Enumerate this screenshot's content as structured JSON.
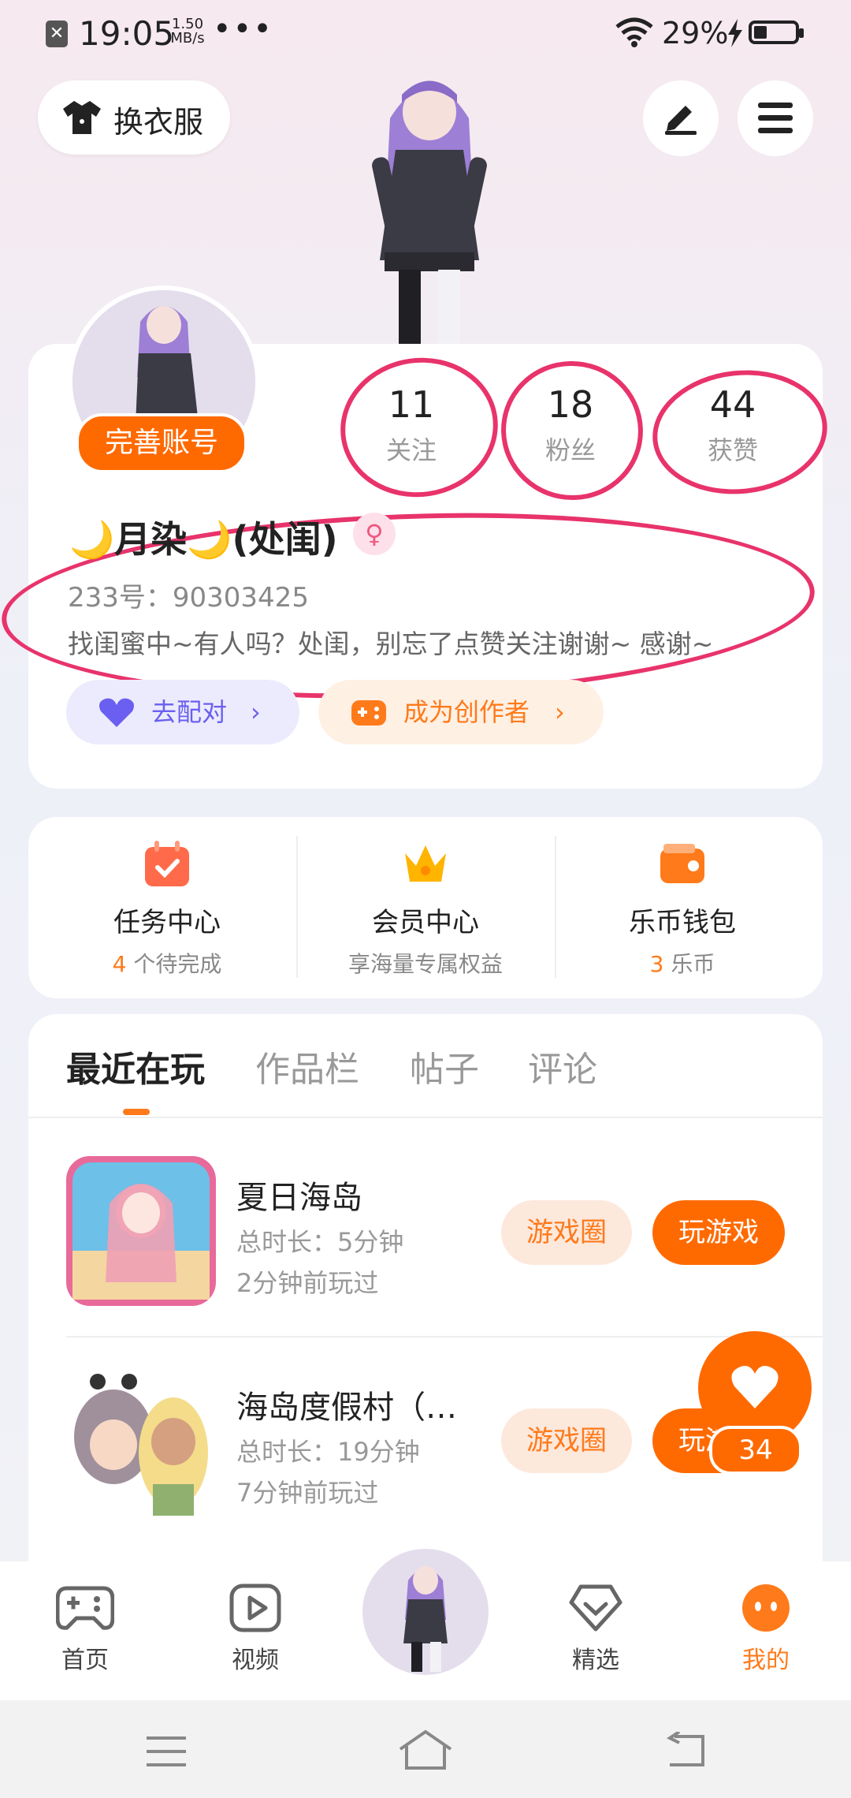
{
  "status_bar": {
    "time": "19:05",
    "speed_value": "1.50",
    "speed_unit": "MB/s",
    "more": "•••",
    "battery_pct": "29%"
  },
  "top": {
    "outfit_label": "换衣服",
    "edit_icon": "edit-icon",
    "menu_icon": "menu-icon"
  },
  "profile": {
    "complete_account": "完善账号",
    "stats": [
      {
        "num": "11",
        "label": "关注"
      },
      {
        "num": "18",
        "label": "粉丝"
      },
      {
        "num": "44",
        "label": "获赞"
      }
    ],
    "name": "🌙月染🌙(处闺)",
    "id_line": "233号：90303425",
    "bio": "找闺蜜中~有人吗？处闺，别忘了点赞关注谢谢~ 感谢~",
    "pair_label": "去配对",
    "creator_label": "成为创作者"
  },
  "services": [
    {
      "title": "任务中心",
      "sub_hl": "4",
      "sub": " 个待完成"
    },
    {
      "title": "会员中心",
      "sub_hl": "",
      "sub": "享海量专属权益"
    },
    {
      "title": "乐币钱包",
      "sub_hl": "3",
      "sub": " 乐币"
    }
  ],
  "tabs": [
    "最近在玩",
    "作品栏",
    "帖子",
    "评论"
  ],
  "games": [
    {
      "title": "夏日海岛",
      "duration": "总时长：5分钟",
      "last": "2分钟前玩过",
      "circle": "游戏圈",
      "play": "玩游戏"
    },
    {
      "title": "海岛度假村（…",
      "duration": "总时长：19分钟",
      "last": "7分钟前玩过",
      "circle": "游戏圈",
      "play": "玩游戏"
    }
  ],
  "fab_count": "34",
  "nav": {
    "home": "首页",
    "video": "视频",
    "featured": "精选",
    "mine": "我的"
  },
  "colors": {
    "accent": "#ff6a00",
    "highlight_marker": "#e8336b",
    "purple": "#6a5ff0"
  }
}
